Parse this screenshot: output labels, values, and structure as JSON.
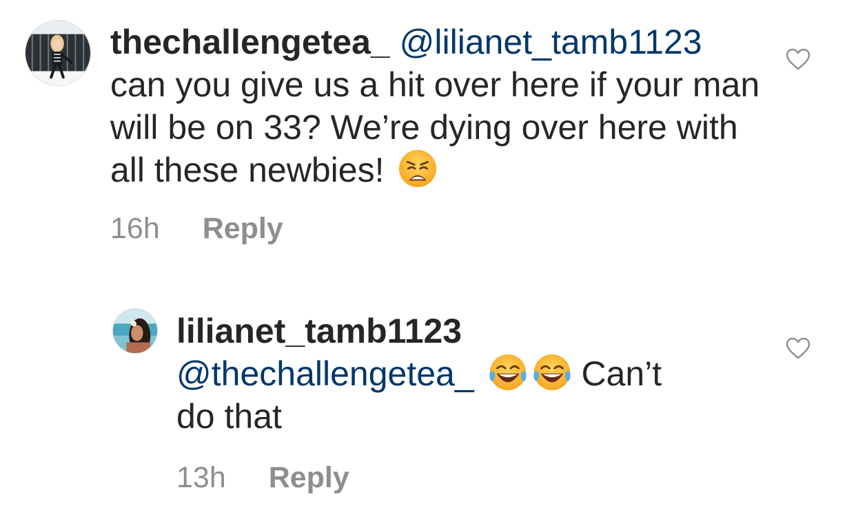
{
  "comments": [
    {
      "username": "thechallengetea_",
      "mention": "@lilianet_tamb1123",
      "text": "can you give us a hit over here if your man will be on 33? We’re dying over here with all these newbies!",
      "emoji": "weary-face-emoji",
      "time": "16h",
      "reply_label": "Reply",
      "like_icon": "heart-outline-icon"
    },
    {
      "username": "lilianet_tamb1123",
      "mention": "@thechallengetea_",
      "emojis": [
        "face-with-tears-of-joy-emoji",
        "face-with-tears-of-joy-emoji"
      ],
      "text_line1": "Can’t",
      "text_line2": "do that",
      "time": "13h",
      "reply_label": "Reply",
      "like_icon": "heart-outline-icon"
    }
  ],
  "colors": {
    "text": "#262626",
    "mention": "#00376b",
    "meta": "#8e8e8e",
    "background": "#ffffff"
  }
}
